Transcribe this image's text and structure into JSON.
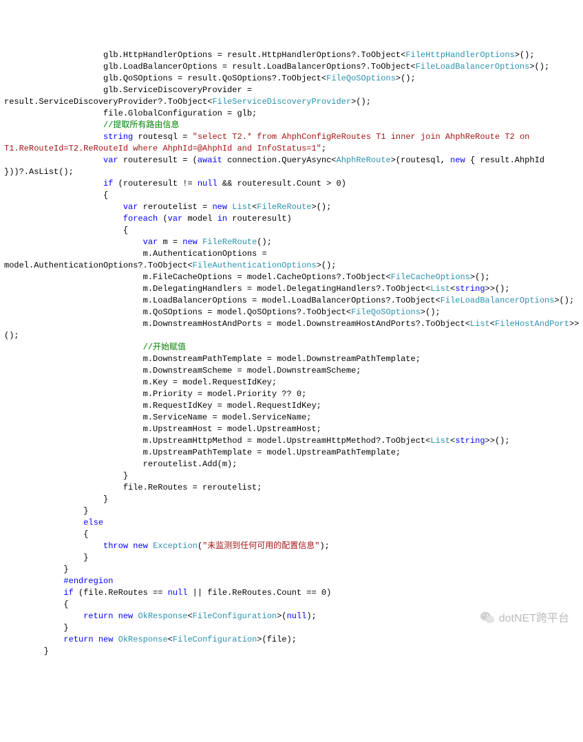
{
  "code": {
    "lines": [
      {
        "indent": 20,
        "frags": [
          {
            "t": "glb.HttpHandlerOptions = result.HttpHandlerOptions?.ToObject<"
          },
          {
            "t": "FileHttpHandlerOptions",
            "c": "typ"
          },
          {
            "t": ">();"
          }
        ]
      },
      {
        "indent": 20,
        "frags": [
          {
            "t": "glb.LoadBalancerOptions = result.LoadBalancerOptions?.ToObject<"
          },
          {
            "t": "FileLoadBalancerOptions",
            "c": "typ"
          },
          {
            "t": ">();"
          }
        ]
      },
      {
        "indent": 20,
        "frags": [
          {
            "t": "glb.QoSOptions = result.QoSOptions?.ToObject<"
          },
          {
            "t": "FileQoSOptions",
            "c": "typ"
          },
          {
            "t": ">();"
          }
        ]
      },
      {
        "indent": 20,
        "frags": [
          {
            "t": "glb.ServiceDiscoveryProvider ="
          }
        ]
      },
      {
        "indent": 0,
        "frags": [
          {
            "t": "result.ServiceDiscoveryProvider?.ToObject<"
          },
          {
            "t": "FileServiceDiscoveryProvider",
            "c": "typ"
          },
          {
            "t": ">();"
          }
        ]
      },
      {
        "indent": 20,
        "frags": [
          {
            "t": "file.GlobalConfiguration = glb;"
          }
        ]
      },
      {
        "indent": 0,
        "frags": [
          {
            "t": ""
          }
        ]
      },
      {
        "indent": 20,
        "frags": [
          {
            "t": "//提取所有路由信息",
            "c": "cmt"
          }
        ]
      },
      {
        "indent": 20,
        "frags": [
          {
            "t": "string",
            "c": "kw"
          },
          {
            "t": " routesql = "
          },
          {
            "t": "\"select T2.* from AhphConfigReRoutes T1 inner join AhphReRoute T2 on ",
            "c": "str"
          }
        ]
      },
      {
        "indent": 0,
        "frags": [
          {
            "t": "T1.ReRouteId=T2.ReRouteId where AhphId=@AhphId and InfoStatus=1\"",
            "c": "str"
          },
          {
            "t": ";"
          }
        ]
      },
      {
        "indent": 20,
        "frags": [
          {
            "t": "var",
            "c": "kw"
          },
          {
            "t": " routeresult = ("
          },
          {
            "t": "await",
            "c": "kw"
          },
          {
            "t": " connection.QueryAsync<"
          },
          {
            "t": "AhphReRoute",
            "c": "typ"
          },
          {
            "t": ">(routesql, "
          },
          {
            "t": "new",
            "c": "kw"
          },
          {
            "t": " { result.AhphId "
          }
        ]
      },
      {
        "indent": 0,
        "frags": [
          {
            "t": "}))?.AsList();"
          }
        ]
      },
      {
        "indent": 20,
        "frags": [
          {
            "t": "if",
            "c": "kw"
          },
          {
            "t": " (routeresult != "
          },
          {
            "t": "null",
            "c": "kw"
          },
          {
            "t": " && routeresult.Count > 0)"
          }
        ]
      },
      {
        "indent": 20,
        "frags": [
          {
            "t": "{"
          }
        ]
      },
      {
        "indent": 24,
        "frags": [
          {
            "t": "var",
            "c": "kw"
          },
          {
            "t": " reroutelist = "
          },
          {
            "t": "new",
            "c": "kw"
          },
          {
            "t": " "
          },
          {
            "t": "List",
            "c": "typ"
          },
          {
            "t": "<"
          },
          {
            "t": "FileReRoute",
            "c": "typ"
          },
          {
            "t": ">();"
          }
        ]
      },
      {
        "indent": 24,
        "frags": [
          {
            "t": "foreach",
            "c": "kw"
          },
          {
            "t": " ("
          },
          {
            "t": "var",
            "c": "kw"
          },
          {
            "t": " model "
          },
          {
            "t": "in",
            "c": "kw"
          },
          {
            "t": " routeresult)"
          }
        ]
      },
      {
        "indent": 24,
        "frags": [
          {
            "t": "{"
          }
        ]
      },
      {
        "indent": 28,
        "frags": [
          {
            "t": "var",
            "c": "kw"
          },
          {
            "t": " m = "
          },
          {
            "t": "new",
            "c": "kw"
          },
          {
            "t": " "
          },
          {
            "t": "FileReRoute",
            "c": "typ"
          },
          {
            "t": "();"
          }
        ]
      },
      {
        "indent": 28,
        "frags": [
          {
            "t": "m.AuthenticationOptions ="
          }
        ]
      },
      {
        "indent": 0,
        "frags": [
          {
            "t": "model.AuthenticationOptions?.ToObject<"
          },
          {
            "t": "FileAuthenticationOptions",
            "c": "typ"
          },
          {
            "t": ">();"
          }
        ]
      },
      {
        "indent": 28,
        "frags": [
          {
            "t": "m.FileCacheOptions = model.CacheOptions?.ToObject<"
          },
          {
            "t": "FileCacheOptions",
            "c": "typ"
          },
          {
            "t": ">();"
          }
        ]
      },
      {
        "indent": 28,
        "frags": [
          {
            "t": "m.DelegatingHandlers = model.DelegatingHandlers?.ToObject<"
          },
          {
            "t": "List",
            "c": "typ"
          },
          {
            "t": "<"
          },
          {
            "t": "string",
            "c": "kw"
          },
          {
            "t": ">>();"
          }
        ]
      },
      {
        "indent": 28,
        "frags": [
          {
            "t": "m.LoadBalancerOptions = model.LoadBalancerOptions?.ToObject<"
          },
          {
            "t": "FileLoadBalancerOptions",
            "c": "typ"
          },
          {
            "t": ">();"
          }
        ]
      },
      {
        "indent": 28,
        "frags": [
          {
            "t": "m.QoSOptions = model.QoSOptions?.ToObject<"
          },
          {
            "t": "FileQoSOptions",
            "c": "typ"
          },
          {
            "t": ">();"
          }
        ]
      },
      {
        "indent": 28,
        "frags": [
          {
            "t": "m.DownstreamHostAndPorts = model.DownstreamHostAndPorts?.ToObject<"
          },
          {
            "t": "List",
            "c": "typ"
          },
          {
            "t": "<"
          },
          {
            "t": "FileHostAndPort",
            "c": "typ"
          },
          {
            "t": ">>"
          }
        ]
      },
      {
        "indent": 0,
        "frags": [
          {
            "t": "();"
          }
        ]
      },
      {
        "indent": 28,
        "frags": [
          {
            "t": "//开始赋值",
            "c": "cmt"
          }
        ]
      },
      {
        "indent": 28,
        "frags": [
          {
            "t": "m.DownstreamPathTemplate = model.DownstreamPathTemplate;"
          }
        ]
      },
      {
        "indent": 28,
        "frags": [
          {
            "t": "m.DownstreamScheme = model.DownstreamScheme;"
          }
        ]
      },
      {
        "indent": 28,
        "frags": [
          {
            "t": "m.Key = model.RequestIdKey;"
          }
        ]
      },
      {
        "indent": 28,
        "frags": [
          {
            "t": "m.Priority = model.Priority ?? 0;"
          }
        ]
      },
      {
        "indent": 28,
        "frags": [
          {
            "t": "m.RequestIdKey = model.RequestIdKey;"
          }
        ]
      },
      {
        "indent": 28,
        "frags": [
          {
            "t": "m.ServiceName = model.ServiceName;"
          }
        ]
      },
      {
        "indent": 28,
        "frags": [
          {
            "t": "m.UpstreamHost = model.UpstreamHost;"
          }
        ]
      },
      {
        "indent": 28,
        "frags": [
          {
            "t": "m.UpstreamHttpMethod = model.UpstreamHttpMethod?.ToObject<"
          },
          {
            "t": "List",
            "c": "typ"
          },
          {
            "t": "<"
          },
          {
            "t": "string",
            "c": "kw"
          },
          {
            "t": ">>();"
          }
        ]
      },
      {
        "indent": 28,
        "frags": [
          {
            "t": "m.UpstreamPathTemplate = model.UpstreamPathTemplate;"
          }
        ]
      },
      {
        "indent": 28,
        "frags": [
          {
            "t": "reroutelist.Add(m);"
          }
        ]
      },
      {
        "indent": 24,
        "frags": [
          {
            "t": "}"
          }
        ]
      },
      {
        "indent": 24,
        "frags": [
          {
            "t": "file.ReRoutes = reroutelist;"
          }
        ]
      },
      {
        "indent": 20,
        "frags": [
          {
            "t": "}"
          }
        ]
      },
      {
        "indent": 16,
        "frags": [
          {
            "t": "}"
          }
        ]
      },
      {
        "indent": 16,
        "frags": [
          {
            "t": "else",
            "c": "kw"
          }
        ]
      },
      {
        "indent": 16,
        "frags": [
          {
            "t": "{"
          }
        ]
      },
      {
        "indent": 20,
        "frags": [
          {
            "t": "throw",
            "c": "kw"
          },
          {
            "t": " "
          },
          {
            "t": "new",
            "c": "kw"
          },
          {
            "t": " "
          },
          {
            "t": "Exception",
            "c": "typ"
          },
          {
            "t": "("
          },
          {
            "t": "\"未监测到任何可用的配置信息\"",
            "c": "str"
          },
          {
            "t": ");"
          }
        ]
      },
      {
        "indent": 16,
        "frags": [
          {
            "t": "}"
          }
        ]
      },
      {
        "indent": 12,
        "frags": [
          {
            "t": "}"
          }
        ]
      },
      {
        "indent": 12,
        "frags": [
          {
            "t": "#endregion",
            "c": "kw"
          }
        ]
      },
      {
        "indent": 12,
        "frags": [
          {
            "t": "if",
            "c": "kw"
          },
          {
            "t": " (file.ReRoutes == "
          },
          {
            "t": "null",
            "c": "kw"
          },
          {
            "t": " || file.ReRoutes.Count == 0)"
          }
        ]
      },
      {
        "indent": 12,
        "frags": [
          {
            "t": "{"
          }
        ]
      },
      {
        "indent": 16,
        "frags": [
          {
            "t": "return",
            "c": "kw"
          },
          {
            "t": " "
          },
          {
            "t": "new",
            "c": "kw"
          },
          {
            "t": " "
          },
          {
            "t": "OkResponse",
            "c": "typ"
          },
          {
            "t": "<"
          },
          {
            "t": "FileConfiguration",
            "c": "typ"
          },
          {
            "t": ">("
          },
          {
            "t": "null",
            "c": "kw"
          },
          {
            "t": ");"
          }
        ]
      },
      {
        "indent": 12,
        "frags": [
          {
            "t": "}"
          }
        ]
      },
      {
        "indent": 12,
        "frags": [
          {
            "t": "return",
            "c": "kw"
          },
          {
            "t": " "
          },
          {
            "t": "new",
            "c": "kw"
          },
          {
            "t": " "
          },
          {
            "t": "OkResponse",
            "c": "typ"
          },
          {
            "t": "<"
          },
          {
            "t": "FileConfiguration",
            "c": "typ"
          },
          {
            "t": ">(file);"
          }
        ]
      },
      {
        "indent": 8,
        "frags": [
          {
            "t": "}"
          }
        ]
      }
    ]
  },
  "watermark": {
    "text": "dotNET跨平台"
  }
}
